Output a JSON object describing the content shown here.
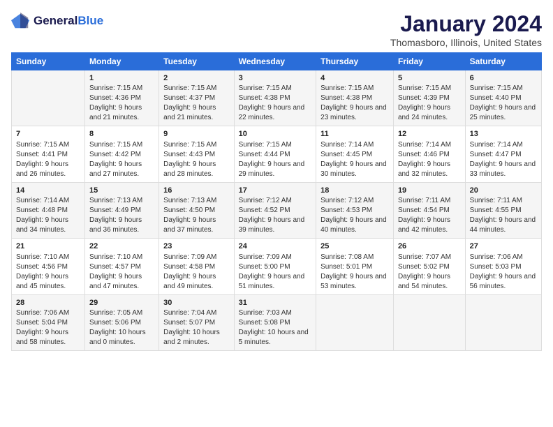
{
  "logo": {
    "line1": "General",
    "line2": "Blue"
  },
  "title": "January 2024",
  "subtitle": "Thomasboro, Illinois, United States",
  "days_header": [
    "Sunday",
    "Monday",
    "Tuesday",
    "Wednesday",
    "Thursday",
    "Friday",
    "Saturday"
  ],
  "weeks": [
    [
      {
        "day": "",
        "sunrise": "",
        "sunset": "",
        "daylight": ""
      },
      {
        "day": "1",
        "sunrise": "Sunrise: 7:15 AM",
        "sunset": "Sunset: 4:36 PM",
        "daylight": "Daylight: 9 hours and 21 minutes."
      },
      {
        "day": "2",
        "sunrise": "Sunrise: 7:15 AM",
        "sunset": "Sunset: 4:37 PM",
        "daylight": "Daylight: 9 hours and 21 minutes."
      },
      {
        "day": "3",
        "sunrise": "Sunrise: 7:15 AM",
        "sunset": "Sunset: 4:38 PM",
        "daylight": "Daylight: 9 hours and 22 minutes."
      },
      {
        "day": "4",
        "sunrise": "Sunrise: 7:15 AM",
        "sunset": "Sunset: 4:38 PM",
        "daylight": "Daylight: 9 hours and 23 minutes."
      },
      {
        "day": "5",
        "sunrise": "Sunrise: 7:15 AM",
        "sunset": "Sunset: 4:39 PM",
        "daylight": "Daylight: 9 hours and 24 minutes."
      },
      {
        "day": "6",
        "sunrise": "Sunrise: 7:15 AM",
        "sunset": "Sunset: 4:40 PM",
        "daylight": "Daylight: 9 hours and 25 minutes."
      }
    ],
    [
      {
        "day": "7",
        "sunrise": "Sunrise: 7:15 AM",
        "sunset": "Sunset: 4:41 PM",
        "daylight": "Daylight: 9 hours and 26 minutes."
      },
      {
        "day": "8",
        "sunrise": "Sunrise: 7:15 AM",
        "sunset": "Sunset: 4:42 PM",
        "daylight": "Daylight: 9 hours and 27 minutes."
      },
      {
        "day": "9",
        "sunrise": "Sunrise: 7:15 AM",
        "sunset": "Sunset: 4:43 PM",
        "daylight": "Daylight: 9 hours and 28 minutes."
      },
      {
        "day": "10",
        "sunrise": "Sunrise: 7:15 AM",
        "sunset": "Sunset: 4:44 PM",
        "daylight": "Daylight: 9 hours and 29 minutes."
      },
      {
        "day": "11",
        "sunrise": "Sunrise: 7:14 AM",
        "sunset": "Sunset: 4:45 PM",
        "daylight": "Daylight: 9 hours and 30 minutes."
      },
      {
        "day": "12",
        "sunrise": "Sunrise: 7:14 AM",
        "sunset": "Sunset: 4:46 PM",
        "daylight": "Daylight: 9 hours and 32 minutes."
      },
      {
        "day": "13",
        "sunrise": "Sunrise: 7:14 AM",
        "sunset": "Sunset: 4:47 PM",
        "daylight": "Daylight: 9 hours and 33 minutes."
      }
    ],
    [
      {
        "day": "14",
        "sunrise": "Sunrise: 7:14 AM",
        "sunset": "Sunset: 4:48 PM",
        "daylight": "Daylight: 9 hours and 34 minutes."
      },
      {
        "day": "15",
        "sunrise": "Sunrise: 7:13 AM",
        "sunset": "Sunset: 4:49 PM",
        "daylight": "Daylight: 9 hours and 36 minutes."
      },
      {
        "day": "16",
        "sunrise": "Sunrise: 7:13 AM",
        "sunset": "Sunset: 4:50 PM",
        "daylight": "Daylight: 9 hours and 37 minutes."
      },
      {
        "day": "17",
        "sunrise": "Sunrise: 7:12 AM",
        "sunset": "Sunset: 4:52 PM",
        "daylight": "Daylight: 9 hours and 39 minutes."
      },
      {
        "day": "18",
        "sunrise": "Sunrise: 7:12 AM",
        "sunset": "Sunset: 4:53 PM",
        "daylight": "Daylight: 9 hours and 40 minutes."
      },
      {
        "day": "19",
        "sunrise": "Sunrise: 7:11 AM",
        "sunset": "Sunset: 4:54 PM",
        "daylight": "Daylight: 9 hours and 42 minutes."
      },
      {
        "day": "20",
        "sunrise": "Sunrise: 7:11 AM",
        "sunset": "Sunset: 4:55 PM",
        "daylight": "Daylight: 9 hours and 44 minutes."
      }
    ],
    [
      {
        "day": "21",
        "sunrise": "Sunrise: 7:10 AM",
        "sunset": "Sunset: 4:56 PM",
        "daylight": "Daylight: 9 hours and 45 minutes."
      },
      {
        "day": "22",
        "sunrise": "Sunrise: 7:10 AM",
        "sunset": "Sunset: 4:57 PM",
        "daylight": "Daylight: 9 hours and 47 minutes."
      },
      {
        "day": "23",
        "sunrise": "Sunrise: 7:09 AM",
        "sunset": "Sunset: 4:58 PM",
        "daylight": "Daylight: 9 hours and 49 minutes."
      },
      {
        "day": "24",
        "sunrise": "Sunrise: 7:09 AM",
        "sunset": "Sunset: 5:00 PM",
        "daylight": "Daylight: 9 hours and 51 minutes."
      },
      {
        "day": "25",
        "sunrise": "Sunrise: 7:08 AM",
        "sunset": "Sunset: 5:01 PM",
        "daylight": "Daylight: 9 hours and 53 minutes."
      },
      {
        "day": "26",
        "sunrise": "Sunrise: 7:07 AM",
        "sunset": "Sunset: 5:02 PM",
        "daylight": "Daylight: 9 hours and 54 minutes."
      },
      {
        "day": "27",
        "sunrise": "Sunrise: 7:06 AM",
        "sunset": "Sunset: 5:03 PM",
        "daylight": "Daylight: 9 hours and 56 minutes."
      }
    ],
    [
      {
        "day": "28",
        "sunrise": "Sunrise: 7:06 AM",
        "sunset": "Sunset: 5:04 PM",
        "daylight": "Daylight: 9 hours and 58 minutes."
      },
      {
        "day": "29",
        "sunrise": "Sunrise: 7:05 AM",
        "sunset": "Sunset: 5:06 PM",
        "daylight": "Daylight: 10 hours and 0 minutes."
      },
      {
        "day": "30",
        "sunrise": "Sunrise: 7:04 AM",
        "sunset": "Sunset: 5:07 PM",
        "daylight": "Daylight: 10 hours and 2 minutes."
      },
      {
        "day": "31",
        "sunrise": "Sunrise: 7:03 AM",
        "sunset": "Sunset: 5:08 PM",
        "daylight": "Daylight: 10 hours and 5 minutes."
      },
      {
        "day": "",
        "sunrise": "",
        "sunset": "",
        "daylight": ""
      },
      {
        "day": "",
        "sunrise": "",
        "sunset": "",
        "daylight": ""
      },
      {
        "day": "",
        "sunrise": "",
        "sunset": "",
        "daylight": ""
      }
    ]
  ]
}
